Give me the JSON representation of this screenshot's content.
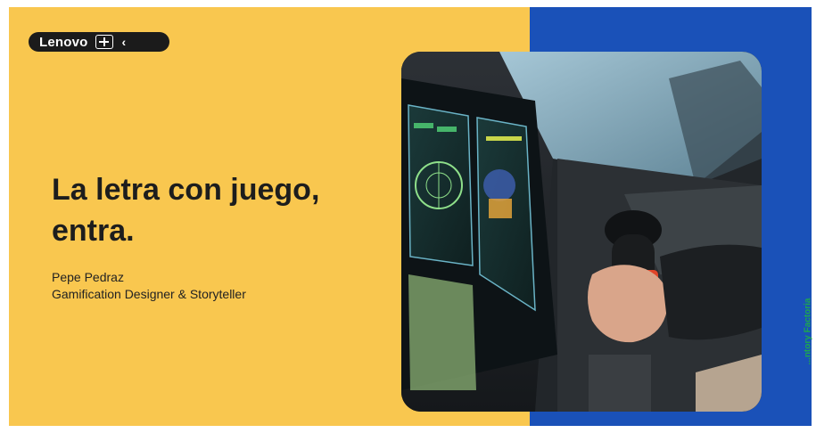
{
  "slide": {
    "brand": {
      "name": "Lenovo",
      "logo_icon": "lenovo-logo-icon",
      "back_icon": "chevron-left-icon"
    },
    "title_line1": "La letra con juego,",
    "title_line2": "entra.",
    "author": "Pepe Pedraz",
    "role": "Gamification Designer & Storyteller",
    "photo": {
      "subject": "cockpit-flight-simulator"
    },
    "colors": {
      "left": "#f9c74f",
      "right": "#1a51b8",
      "text": "#1d1d1d"
    }
  },
  "edge_text": "...ntory Factoria"
}
